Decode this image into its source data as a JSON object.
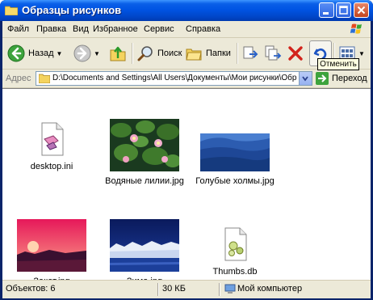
{
  "window": {
    "title": "Образцы рисунков"
  },
  "menu": [
    "Файл",
    "Правка",
    "Вид",
    "Избранное",
    "Сервис",
    "Справка"
  ],
  "toolbar": {
    "back_label": "Назад",
    "search_label": "Поиск",
    "folders_label": "Папки"
  },
  "tooltip": {
    "text": "Отменить"
  },
  "address": {
    "label": "Адрес",
    "path": "D:\\Documents and Settings\\All Users\\Документы\\Мои рисунки\\Образ",
    "go_label": "Переход"
  },
  "files": [
    {
      "name": "desktop.ini",
      "icon": "ini-file-icon"
    },
    {
      "name": "Водяные лилии.jpg",
      "icon": "water-lilies-thumbnail"
    },
    {
      "name": "Голубые холмы.jpg",
      "icon": "blue-hills-thumbnail"
    },
    {
      "name": "Закат.jpg",
      "icon": "sunset-thumbnail"
    },
    {
      "name": "Зима.jpg",
      "icon": "winter-thumbnail"
    },
    {
      "name": "Thumbs.db",
      "icon": "thumbs-db-icon"
    }
  ],
  "status": {
    "objects": "Объектов: 6",
    "size": "30 КБ",
    "location": "Мой компьютер"
  }
}
